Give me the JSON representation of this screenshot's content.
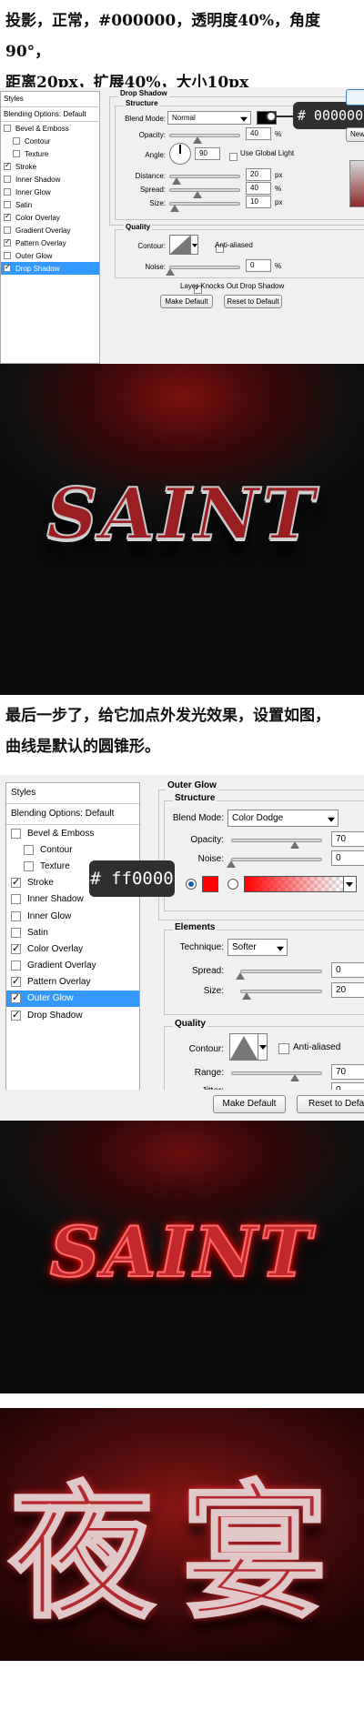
{
  "step_drop_shadow": {
    "line1": "投影，正常，#000000，透明度40%，角度90°，",
    "line2": "距离20px，扩展40%，大小10px"
  },
  "drop_shadow_dialog": {
    "styles": {
      "header": "Styles",
      "blending": "Blending Options: Default",
      "items": [
        {
          "label": "Bevel & Emboss",
          "checked": false,
          "selected": false,
          "indent": false
        },
        {
          "label": "Contour",
          "checked": false,
          "selected": false,
          "indent": true
        },
        {
          "label": "Texture",
          "checked": false,
          "selected": false,
          "indent": true
        },
        {
          "label": "Stroke",
          "checked": true,
          "selected": false,
          "indent": false
        },
        {
          "label": "Inner Shadow",
          "checked": false,
          "selected": false,
          "indent": false
        },
        {
          "label": "Inner Glow",
          "checked": false,
          "selected": false,
          "indent": false
        },
        {
          "label": "Satin",
          "checked": false,
          "selected": false,
          "indent": false
        },
        {
          "label": "Color Overlay",
          "checked": true,
          "selected": false,
          "indent": false
        },
        {
          "label": "Gradient Overlay",
          "checked": false,
          "selected": false,
          "indent": false
        },
        {
          "label": "Pattern Overlay",
          "checked": true,
          "selected": false,
          "indent": false
        },
        {
          "label": "Outer Glow",
          "checked": false,
          "selected": false,
          "indent": false
        },
        {
          "label": "Drop Shadow",
          "checked": true,
          "selected": true,
          "indent": false
        }
      ]
    },
    "title": "Drop Shadow",
    "structure": "Structure",
    "blend_mode_label": "Blend Mode:",
    "blend_mode_value": "Normal",
    "color_hex": "#000000",
    "opacity_label": "Opacity:",
    "opacity_value": "40",
    "opacity_percent": 40,
    "angle_label": "Angle:",
    "angle_value": "90",
    "global_light_label": "Use Global Light",
    "distance_label": "Distance:",
    "distance_value": "20",
    "distance_percent": 10,
    "spread_label": "Spread:",
    "spread_value": "40",
    "spread_percent": 40,
    "size_label": "Size:",
    "size_value": "10",
    "size_percent": 8,
    "unit_percent": "%",
    "unit_px": "px",
    "quality": "Quality",
    "contour_label": "Contour:",
    "anti_aliased_label": "Anti-aliased",
    "noise_label": "Noise:",
    "noise_value": "0",
    "knockout_label": "Layer Knocks Out Drop Shadow",
    "make_default": "Make Default",
    "reset_default": "Reset to Default",
    "right_button_partial": "New",
    "tooltip": "# 000000"
  },
  "art1": {
    "word": "SAINT",
    "color": "#9a1e22"
  },
  "step_outer_glow": {
    "line1": "最后一步了，给它加点外发光效果，设置如图，",
    "line2": "曲线是默认的圆锥形。"
  },
  "outer_glow_dialog": {
    "styles": {
      "header": "Styles",
      "blending": "Blending Options: Default",
      "items": [
        {
          "label": "Bevel & Emboss",
          "checked": false,
          "selected": false,
          "indent": false
        },
        {
          "label": "Contour",
          "checked": false,
          "selected": false,
          "indent": true
        },
        {
          "label": "Texture",
          "checked": false,
          "selected": false,
          "indent": true
        },
        {
          "label": "Stroke",
          "checked": true,
          "selected": false,
          "indent": false
        },
        {
          "label": "Inner Shadow",
          "checked": false,
          "selected": false,
          "indent": false
        },
        {
          "label": "Inner Glow",
          "checked": false,
          "selected": false,
          "indent": false
        },
        {
          "label": "Satin",
          "checked": false,
          "selected": false,
          "indent": false
        },
        {
          "label": "Color Overlay",
          "checked": true,
          "selected": false,
          "indent": false
        },
        {
          "label": "Gradient Overlay",
          "checked": false,
          "selected": false,
          "indent": false
        },
        {
          "label": "Pattern Overlay",
          "checked": true,
          "selected": false,
          "indent": false
        },
        {
          "label": "Outer Glow",
          "checked": true,
          "selected": true,
          "indent": false
        },
        {
          "label": "Drop Shadow",
          "checked": true,
          "selected": false,
          "indent": false
        }
      ]
    },
    "title": "Outer Glow",
    "structure": "Structure",
    "blend_mode_label": "Blend Mode:",
    "blend_mode_value": "Color Dodge",
    "opacity_label": "Opacity:",
    "opacity_value": "70",
    "opacity_percent": 70,
    "noise_label": "Noise:",
    "noise_value": "0",
    "noise_percent": 0,
    "color_hex": "#ff0000",
    "tooltip": "# ff0000",
    "elements": "Elements",
    "technique_label": "Technique:",
    "technique_value": "Softer",
    "spread_label": "Spread:",
    "spread_value": "0",
    "spread_percent": 0,
    "size_label": "Size:",
    "size_value": "20",
    "size_percent": 8,
    "quality": "Quality",
    "contour_label": "Contour:",
    "anti_aliased_label": "Anti-aliased",
    "range_label": "Range:",
    "range_value": "70",
    "range_percent": 70,
    "jitter_label": "Jitter:",
    "jitter_value": "0",
    "jitter_percent": 0,
    "make_default": "Make Default",
    "reset_default": "Reset to Defa"
  },
  "art2": {
    "word": "SAINT",
    "color": "#c2282c"
  },
  "art3": {
    "word": "夜宴",
    "color": "#b52a2e"
  }
}
